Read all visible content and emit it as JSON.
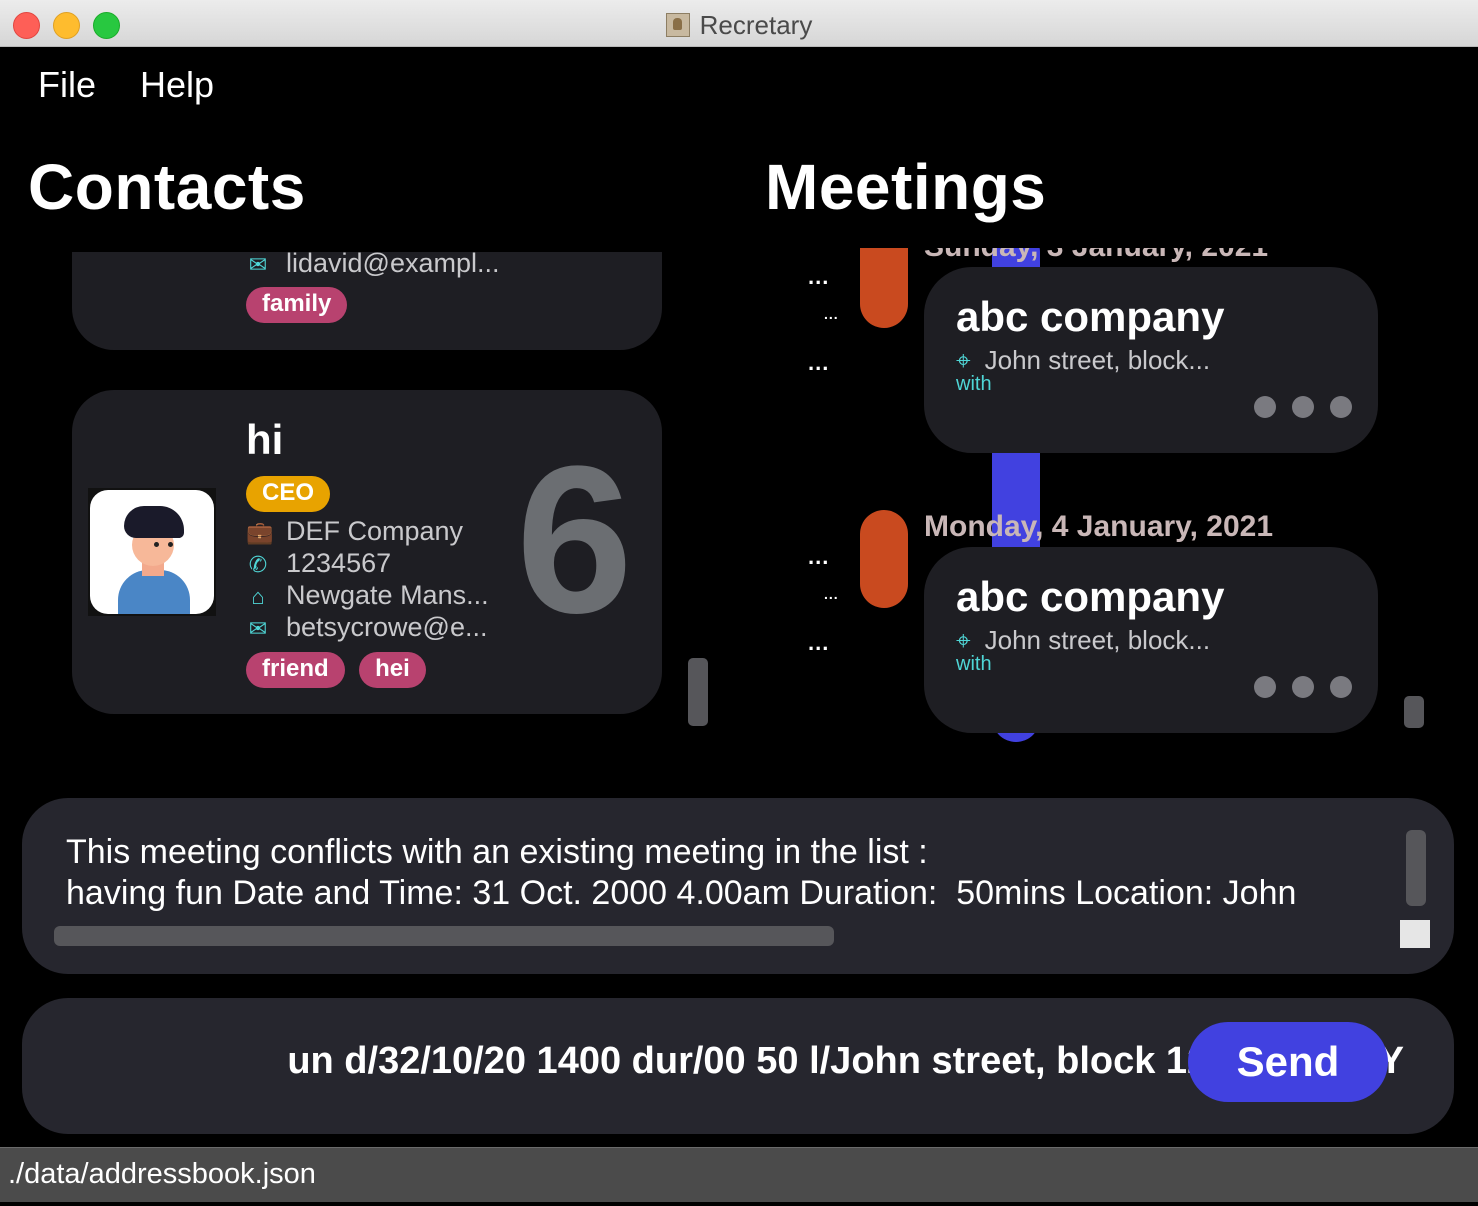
{
  "window": {
    "title": "Recretary"
  },
  "menu": {
    "file": "File",
    "help": "Help"
  },
  "contacts": {
    "title": "Contacts",
    "card_partial": {
      "email": "lidavid@exampl...",
      "tags": [
        "family"
      ]
    },
    "card_hi": {
      "name": "hi",
      "role_tag": "CEO",
      "company": "DEF Company",
      "phone": "1234567",
      "address": "Newgate Mans...",
      "email": "betsycrowe@e...",
      "tags": [
        "friend",
        "hei"
      ],
      "index": "6"
    }
  },
  "meetings": {
    "title": "Meetings",
    "items": [
      {
        "date": "Sunday, 3 January, 2021",
        "title": "abc company",
        "location": "John street, block...",
        "with": "with"
      },
      {
        "date": "Monday, 4 January, 2021",
        "title": "abc company",
        "location": "John street, block...",
        "with": "with"
      }
    ],
    "ellipsis_large": "...",
    "ellipsis_small": "..."
  },
  "result": {
    "line1": "This meeting conflicts with an existing meeting in the list :",
    "line2": "having fun Date and Time: 31 Oct. 2000 4.00am Duration:  50mins Location: John"
  },
  "command": {
    "value": "un d/32/10/20 1400 dur/00 50 l/John street, block 123, #01-01 Y",
    "send_label": "Send"
  },
  "status_bar": {
    "path": "./data/addressbook.json"
  },
  "colors": {
    "accent": "#4141e0",
    "tag": "#b8426f",
    "ceo": "#e8a300",
    "timeline": "#c94a1f",
    "icon": "#4fd6d6"
  }
}
